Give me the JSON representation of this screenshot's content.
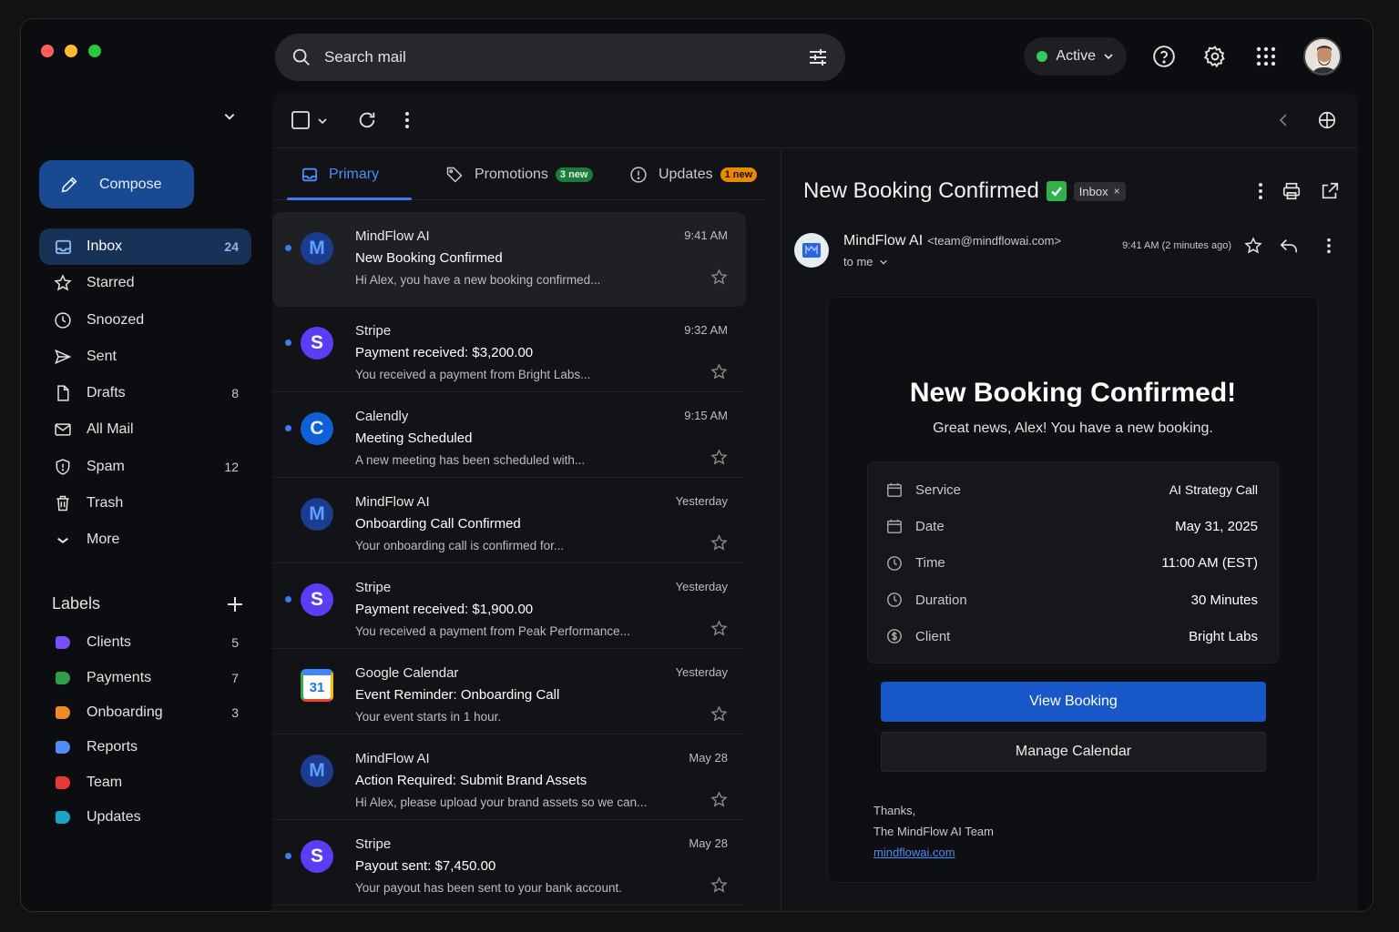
{
  "search": {
    "placeholder": "Search mail"
  },
  "status": {
    "label": "Active"
  },
  "compose": {
    "label": "Compose"
  },
  "nav": [
    {
      "label": "Inbox",
      "count": "24"
    },
    {
      "label": "Starred",
      "count": ""
    },
    {
      "label": "Snoozed",
      "count": ""
    },
    {
      "label": "Sent",
      "count": ""
    },
    {
      "label": "Drafts",
      "count": "8"
    },
    {
      "label": "All Mail",
      "count": ""
    },
    {
      "label": "Spam",
      "count": "12"
    },
    {
      "label": "Trash",
      "count": ""
    },
    {
      "label": "More",
      "count": ""
    }
  ],
  "labels": {
    "title": "Labels",
    "items": [
      {
        "label": "Clients",
        "count": "5",
        "color": "#7c4dff"
      },
      {
        "label": "Payments",
        "count": "7",
        "color": "#2e9e47"
      },
      {
        "label": "Onboarding",
        "count": "3",
        "color": "#f08a24"
      },
      {
        "label": "Reports",
        "count": "",
        "color": "#4c8df6"
      },
      {
        "label": "Team",
        "count": "",
        "color": "#e53935"
      },
      {
        "label": "Updates",
        "count": "",
        "color": "#1aa3c4"
      }
    ]
  },
  "tabs": [
    {
      "label": "Primary",
      "badge": ""
    },
    {
      "label": "Promotions",
      "badge": "3 new",
      "badge_color": "#1f7a3a"
    },
    {
      "label": "Updates",
      "badge": "1 new",
      "badge_color": "#e68a00"
    }
  ],
  "emails": [
    {
      "sender": "MindFlow AI",
      "subject": "New Booking Confirmed",
      "snippet": "Hi Alex, you have a new booking confirmed...",
      "time": "9:41 AM",
      "initial": "M",
      "avatar": "mindflow",
      "unread": true
    },
    {
      "sender": "Stripe",
      "subject": "Payment received: $3,200.00",
      "snippet": "You received a payment from Bright Labs...",
      "time": "9:32 AM",
      "initial": "S",
      "avatar": "stripe",
      "unread": true
    },
    {
      "sender": "Calendly",
      "subject": "Meeting Scheduled",
      "snippet": "A new meeting has been scheduled with...",
      "time": "9:15 AM",
      "initial": "C",
      "avatar": "calendly",
      "unread": true
    },
    {
      "sender": "MindFlow AI",
      "subject": "Onboarding Call Confirmed",
      "snippet": "Your onboarding call is confirmed for...",
      "time": "Yesterday",
      "initial": "M",
      "avatar": "mindflow",
      "unread": false
    },
    {
      "sender": "Stripe",
      "subject": "Payment received: $1,900.00",
      "snippet": "You received a payment from Peak Performance...",
      "time": "Yesterday",
      "initial": "S",
      "avatar": "stripe",
      "unread": true
    },
    {
      "sender": "Google Calendar",
      "subject": "Event Reminder: Onboarding Call",
      "snippet": "Your event starts in 1 hour.",
      "time": "Yesterday",
      "initial": "31",
      "avatar": "gcal",
      "unread": false
    },
    {
      "sender": "MindFlow AI",
      "subject": "Action Required: Submit Brand Assets",
      "snippet": "Hi Alex, please upload your brand assets so we can...",
      "time": "May 28",
      "initial": "M",
      "avatar": "mindflow",
      "unread": false
    },
    {
      "sender": "Stripe",
      "subject": "Payout sent: $7,450.00",
      "snippet": "Your payout has been sent to your bank account.",
      "time": "May 28",
      "initial": "S",
      "avatar": "stripe",
      "unread": true
    }
  ],
  "reader": {
    "subject": "New Booking Confirmed",
    "chip": "Inbox",
    "chip_close": "×",
    "from_name": "MindFlow AI",
    "from_email": "<team@mindflowai.com>",
    "to": "to me",
    "time": "9:41 AM (2 minutes ago)",
    "card": {
      "title": "New Booking Confirmed!",
      "subtitle": "Great news, Alex! You have a new booking.",
      "details": [
        {
          "key": "Service",
          "value": "AI Strategy Call",
          "icon": "calendar-icon"
        },
        {
          "key": "Date",
          "value": "May 31, 2025",
          "icon": "calendar-icon"
        },
        {
          "key": "Time",
          "value": "11:00 AM (EST)",
          "icon": "clock-icon"
        },
        {
          "key": "Duration",
          "value": "30 Minutes",
          "icon": "clock-icon"
        },
        {
          "key": "Client",
          "value": "Bright Labs",
          "icon": "dollar-circle-icon"
        }
      ],
      "primary_button": "View Booking",
      "secondary_button": "Manage Calendar",
      "sig_line1": "Thanks,",
      "sig_line2": "The MindFlow AI Team",
      "sig_link": "mindflowai.com"
    }
  },
  "colors": {
    "accent": "#3b7cf0",
    "compose_bg": "#184a94",
    "primary_button": "#1857c8",
    "stripe": "#5b3df5",
    "mindflow": "#1a3d8f"
  }
}
